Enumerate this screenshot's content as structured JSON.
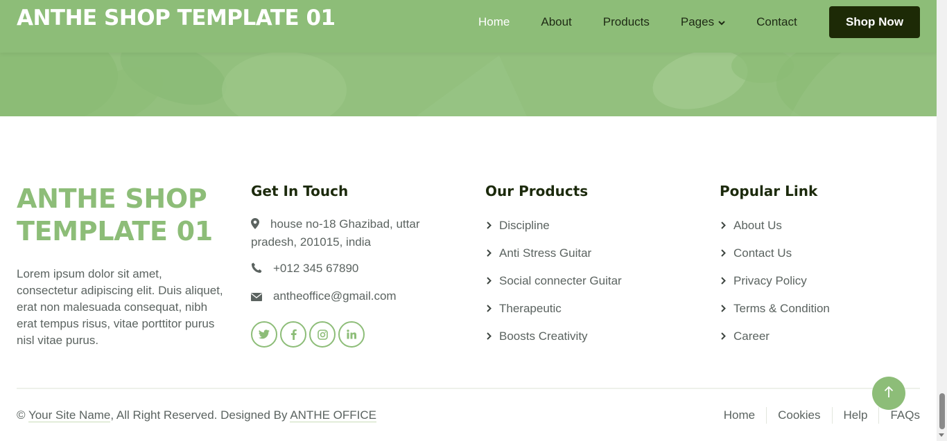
{
  "navbar": {
    "brand": "ANTHE SHOP TEMPLATE 01",
    "links": [
      {
        "label": "Home",
        "active": true
      },
      {
        "label": "About"
      },
      {
        "label": "Products"
      },
      {
        "label": "Pages",
        "dropdown": true
      },
      {
        "label": "Contact"
      }
    ],
    "cta": "Shop Now"
  },
  "footer": {
    "brand": "ANTHE SHOP TEMPLATE 01",
    "about": "Lorem ipsum dolor sit amet, consectetur adipiscing elit. Duis aliquet, erat non malesuada consequat, nibh erat tempus risus, vitae porttitor purus nisl vitae purus.",
    "contact": {
      "title": "Get In Touch",
      "address": "house no-18 Ghazibad, uttar pradesh, 201015, india",
      "phone": "+012 345 67890",
      "email": "antheoffice@gmail.com",
      "socials": [
        "twitter-icon",
        "facebook-icon",
        "instagram-icon",
        "linkedin-icon"
      ]
    },
    "products": {
      "title": "Our Products",
      "items": [
        "Discipline",
        "Anti Stress Guitar",
        "Social connecter Guitar",
        "Therapeutic",
        "Boosts Creativity"
      ]
    },
    "popular": {
      "title": "Popular Link",
      "items": [
        "About Us",
        "Contact Us",
        "Privacy Policy",
        "Terms & Condition",
        "Career"
      ]
    },
    "copyright": {
      "prefix": "© ",
      "site_name": "Your Site Name",
      "middle": ", All Right Reserved. Designed By ",
      "designer": "ANTHE OFFICE"
    },
    "bottom_links": [
      "Home",
      "Cookies",
      "Help",
      "FAQs"
    ]
  },
  "colors": {
    "accent": "#8dbd78",
    "dark": "#1d2a06",
    "text": "#5b6360"
  }
}
